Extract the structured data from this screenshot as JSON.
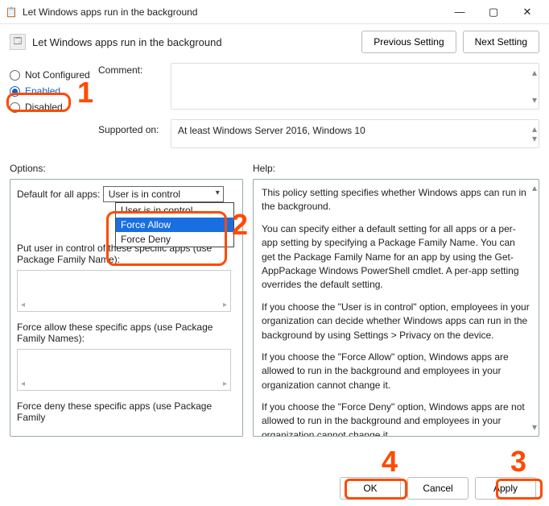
{
  "window": {
    "title": "Let Windows apps run in the background",
    "min": "—",
    "max": "▢",
    "close": "✕"
  },
  "header": {
    "title": "Let Windows apps run in the background",
    "prev": "Previous Setting",
    "next": "Next Setting"
  },
  "radios": {
    "not_configured": "Not Configured",
    "enabled": "Enabled",
    "disabled": "Disabled",
    "selected": "enabled"
  },
  "comment": {
    "label": "Comment:"
  },
  "supported": {
    "label": "Supported on:",
    "value": "At least Windows Server 2016, Windows 10"
  },
  "options": {
    "heading": "Options:",
    "default_label": "Default for all apps:",
    "default_value": "User is in control",
    "dropdown": {
      "opt0": "User is in control",
      "opt1": "Force Allow",
      "opt2": "Force Deny"
    },
    "put_label": "Put user in control of these specific apps (use Package Family Name):",
    "force_allow_label": "Force allow these specific apps (use Package Family Names):",
    "force_deny_label": "Force deny these specific apps (use Package Family"
  },
  "help": {
    "heading": "Help:",
    "p1": "This policy setting specifies whether Windows apps can run in the background.",
    "p2": "You can specify either a default setting for all apps or a per-app setting by specifying a Package Family Name. You can get the Package Family Name for an app by using the Get-AppPackage Windows PowerShell cmdlet. A per-app setting overrides the default setting.",
    "p3": "If you choose the \"User is in control\" option, employees in your organization can decide whether Windows apps can run in the background by using Settings > Privacy on the device.",
    "p4": "If you choose the \"Force Allow\" option, Windows apps are allowed to run in the background and employees in your organization cannot change it.",
    "p5": "If you choose the \"Force Deny\" option, Windows apps are not allowed to run in the background and employees in your organization cannot change it."
  },
  "buttons": {
    "ok": "OK",
    "cancel": "Cancel",
    "apply": "Apply"
  },
  "annotations": {
    "n1": "1",
    "n2": "2",
    "n3": "3",
    "n4": "4"
  }
}
